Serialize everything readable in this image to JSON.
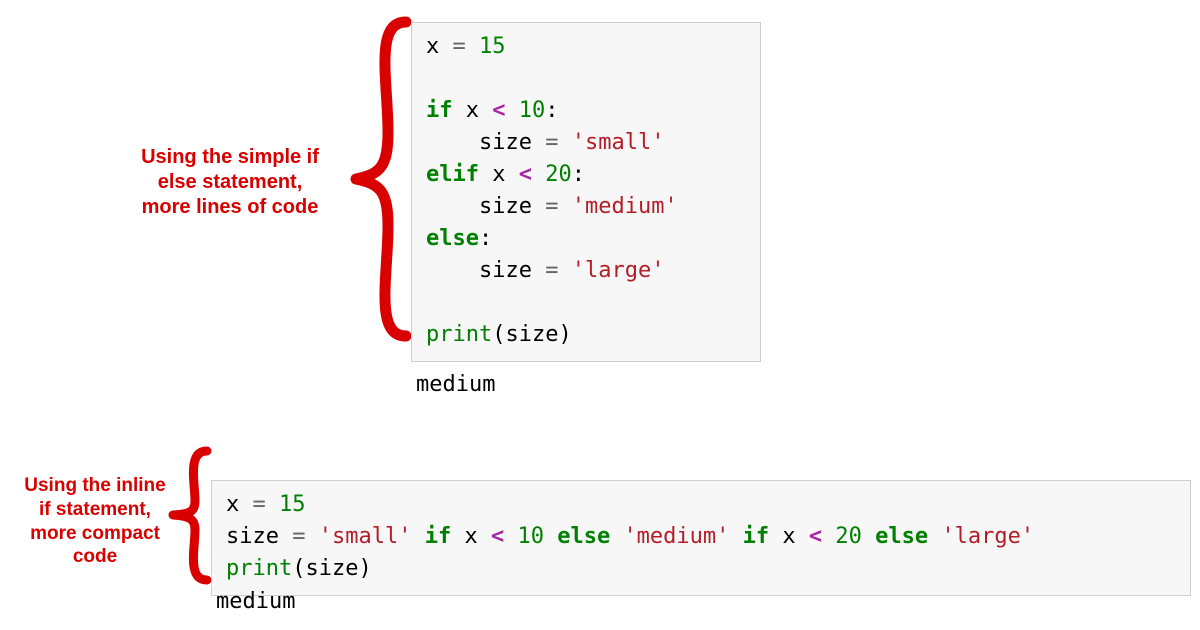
{
  "captions": {
    "top": "Using the simple if\nelse statement,\nmore lines of code",
    "bottom": "Using the inline\nif statement,\nmore compact\ncode"
  },
  "outputs": {
    "top": "medium",
    "bottom": "medium"
  },
  "code": {
    "top": [
      [
        "var",
        "x"
      ],
      [
        "plain",
        " "
      ],
      [
        "op",
        "="
      ],
      [
        "plain",
        " "
      ],
      [
        "num",
        "15"
      ],
      [
        "nl",
        ""
      ],
      [
        "nl",
        ""
      ],
      [
        "kw",
        "if"
      ],
      [
        "plain",
        " "
      ],
      [
        "var",
        "x"
      ],
      [
        "plain",
        " "
      ],
      [
        "opb",
        "<"
      ],
      [
        "plain",
        " "
      ],
      [
        "num",
        "10"
      ],
      [
        "pun",
        ":"
      ],
      [
        "nl",
        ""
      ],
      [
        "plain",
        "    "
      ],
      [
        "var",
        "size"
      ],
      [
        "plain",
        " "
      ],
      [
        "op",
        "="
      ],
      [
        "plain",
        " "
      ],
      [
        "str",
        "'small'"
      ],
      [
        "nl",
        ""
      ],
      [
        "kw",
        "elif"
      ],
      [
        "plain",
        " "
      ],
      [
        "var",
        "x"
      ],
      [
        "plain",
        " "
      ],
      [
        "opb",
        "<"
      ],
      [
        "plain",
        " "
      ],
      [
        "num",
        "20"
      ],
      [
        "pun",
        ":"
      ],
      [
        "nl",
        ""
      ],
      [
        "plain",
        "    "
      ],
      [
        "var",
        "size"
      ],
      [
        "plain",
        " "
      ],
      [
        "op",
        "="
      ],
      [
        "plain",
        " "
      ],
      [
        "str",
        "'medium'"
      ],
      [
        "nl",
        ""
      ],
      [
        "kw",
        "else"
      ],
      [
        "pun",
        ":"
      ],
      [
        "nl",
        ""
      ],
      [
        "plain",
        "    "
      ],
      [
        "var",
        "size"
      ],
      [
        "plain",
        " "
      ],
      [
        "op",
        "="
      ],
      [
        "plain",
        " "
      ],
      [
        "str",
        "'large'"
      ],
      [
        "nl",
        ""
      ],
      [
        "nl",
        ""
      ],
      [
        "fn",
        "print"
      ],
      [
        "pun",
        "("
      ],
      [
        "var",
        "size"
      ],
      [
        "pun",
        ")"
      ]
    ],
    "bottom": [
      [
        "var",
        "x"
      ],
      [
        "plain",
        " "
      ],
      [
        "op",
        "="
      ],
      [
        "plain",
        " "
      ],
      [
        "num",
        "15"
      ],
      [
        "nl",
        ""
      ],
      [
        "var",
        "size"
      ],
      [
        "plain",
        " "
      ],
      [
        "op",
        "="
      ],
      [
        "plain",
        " "
      ],
      [
        "str",
        "'small'"
      ],
      [
        "plain",
        " "
      ],
      [
        "kw",
        "if"
      ],
      [
        "plain",
        " "
      ],
      [
        "var",
        "x"
      ],
      [
        "plain",
        " "
      ],
      [
        "opb",
        "<"
      ],
      [
        "plain",
        " "
      ],
      [
        "num",
        "10"
      ],
      [
        "plain",
        " "
      ],
      [
        "kw",
        "else"
      ],
      [
        "plain",
        " "
      ],
      [
        "str",
        "'medium'"
      ],
      [
        "plain",
        " "
      ],
      [
        "kw",
        "if"
      ],
      [
        "plain",
        " "
      ],
      [
        "var",
        "x"
      ],
      [
        "plain",
        " "
      ],
      [
        "opb",
        "<"
      ],
      [
        "plain",
        " "
      ],
      [
        "num",
        "20"
      ],
      [
        "plain",
        " "
      ],
      [
        "kw",
        "else"
      ],
      [
        "plain",
        " "
      ],
      [
        "str",
        "'large'"
      ],
      [
        "nl",
        ""
      ],
      [
        "fn",
        "print"
      ],
      [
        "pun",
        "("
      ],
      [
        "var",
        "size"
      ],
      [
        "pun",
        ")"
      ]
    ]
  }
}
